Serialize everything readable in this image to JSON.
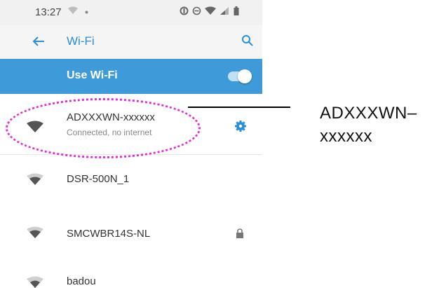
{
  "status_bar": {
    "time": "13:27",
    "icons": [
      "wifi-status-icon",
      "dot-icon",
      "data-saver-icon",
      "dnd-icon",
      "wifi-signal-icon",
      "cell-signal-icon",
      "battery-icon"
    ]
  },
  "app_bar": {
    "title": "Wi-Fi",
    "back_icon": "back-arrow-icon",
    "search_icon": "search-icon"
  },
  "use_wifi": {
    "label": "Use Wi-Fi",
    "enabled": true
  },
  "networks": [
    {
      "name": "ADXXXWN-xxxxxx",
      "status": "Connected, no internet",
      "secured": false,
      "settings_icon": "gear-icon"
    },
    {
      "name": "DSR-500N_1",
      "status": "",
      "secured": false
    },
    {
      "name": "SMCWBR14S-NL",
      "status": "",
      "secured": true,
      "lock_icon": "lock-icon"
    },
    {
      "name": "badou",
      "status": "",
      "secured": false
    }
  ],
  "annotation": {
    "label_line1": "ADXXXWN–",
    "label_line2": "xxxxxx",
    "highlight_color": "#e62ad8"
  },
  "colors": {
    "accent": "#2a8fd4",
    "switch_bar": "#3e9ad9"
  }
}
